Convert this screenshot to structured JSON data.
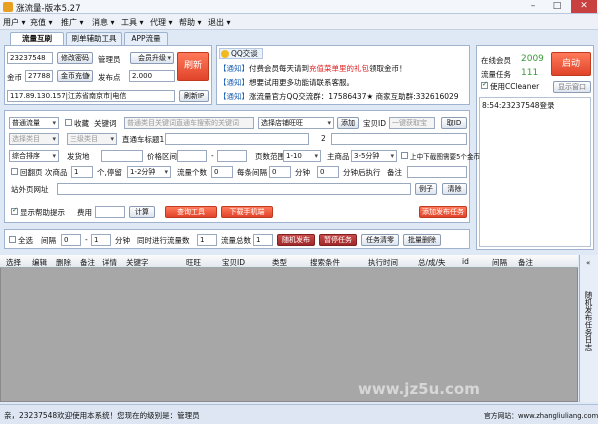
{
  "window": {
    "title": "涨流量-版本5.27",
    "min": "–",
    "max": "□",
    "close": "✕"
  },
  "menu": [
    "用户 ▾",
    "充值 ▾",
    "推广 ▾",
    "消息 ▾",
    "工具 ▾",
    "代理 ▾",
    "帮助 ▾",
    "退出 ▾"
  ],
  "tabs": [
    "流量互刷",
    "刷单辅助工具",
    "APP流量"
  ],
  "account": {
    "username": "23237548",
    "change_pwd": "修改密码",
    "role": "管理员",
    "upgrade": "会员升级",
    "refresh": "刷新",
    "coins_label": "金币",
    "coins": "27788",
    "recharge": "金币充值",
    "publish_label": "发布点",
    "publish_points": "2.000",
    "ip_info": "117.89.130.157|江苏省南京市|电信",
    "refresh_ip": "刷新IP"
  },
  "qq": {
    "header": "QQ交谈",
    "notices": [
      {
        "tag": "【通知】",
        "text": "付费会员每天请到",
        "red": "充值菜单里的礼包",
        "after": "领取金币！"
      },
      {
        "tag": "【通知】",
        "text": "想要试用更多功能请联系客服。",
        "red": "",
        "after": ""
      },
      {
        "tag": "【通知】",
        "text": "涨流量官方QQ交流群：17586437★ 商家互助群:332616029",
        "red": "",
        "after": ""
      }
    ]
  },
  "right_panel": {
    "online_label": "在线会员",
    "online_count": "2009",
    "tasks_label": "流量任务",
    "tasks_count": "111",
    "start": "启动",
    "ccleaner": "使用CCleaner",
    "show_window": "显示窗口",
    "log": "8:54:23237548登录"
  },
  "task_form": {
    "flow_type": "普通流量",
    "favorite": "收藏",
    "keyword_label": "关键词",
    "keyword_placeholder": "普通类目关键词直通车搜索的关键词",
    "shop_select": "选择店铺旺旺",
    "add": "添加",
    "baobei_label": "宝贝ID",
    "baobei_placeholder": "一键获取宝",
    "fetch_id": "取ID",
    "cat_select": "选择类目",
    "cat_three": "三级类目",
    "ztc_label": "直通车标题1",
    "ztc_num": "2",
    "sort": "综合排序",
    "ship_label": "发货地",
    "price_label": "价格区间",
    "dash": "-",
    "page_label": "页数范围",
    "page_range": "1-10",
    "main_label": "主商品",
    "main_range": "3-5分钟",
    "upload_img": "上中下截图需要5个金币",
    "back_page": "回翻页",
    "secondary_label": "次商品",
    "secondary_count": "1",
    "stay_label": "个,停留",
    "stay_range": "1-2分钟",
    "flow_count_label": "流量个数",
    "flow_count": "0",
    "interval_label": "每条间隔",
    "interval": "0",
    "min_label": "分钟",
    "later": "0",
    "after_exec": "分钟后执行",
    "remark_label": "备注",
    "site_label": "站外页网址",
    "example": "例子",
    "clear": "清除",
    "help_hint": "显示帮助提示",
    "fee_label": "费用",
    "calc": "计算",
    "query_tool": "查询工具",
    "mobile": "下载手机端",
    "add_task": "添加发布任务"
  },
  "batch": {
    "select_all": "全选",
    "interval_label": "间隔",
    "from": "0",
    "to": "1",
    "minutes": "分钟",
    "sync_label": "同时进行流量数",
    "sync": "1",
    "total_label": "流量总数",
    "total": "1",
    "random_publish": "随机发布",
    "pause_task": "暂停任务",
    "task_clear": "任务清零",
    "batch_delete": "批量删除"
  },
  "table": {
    "headers": [
      "选择",
      "编辑",
      "删除",
      "备注",
      "详情",
      "关键字",
      "旺旺",
      "宝贝ID",
      "类型",
      "搜索条件",
      "执行时间",
      "总/成/失",
      "id",
      "间隔",
      "备注"
    ]
  },
  "side_tab": "随机发布任务日志",
  "status": {
    "left": "亲，23237548欢迎使用本系统！您现在的级别是：管理员",
    "right": "官方网站：www.zhangliuliang.com"
  },
  "watermark": "www.jz5u.com"
}
